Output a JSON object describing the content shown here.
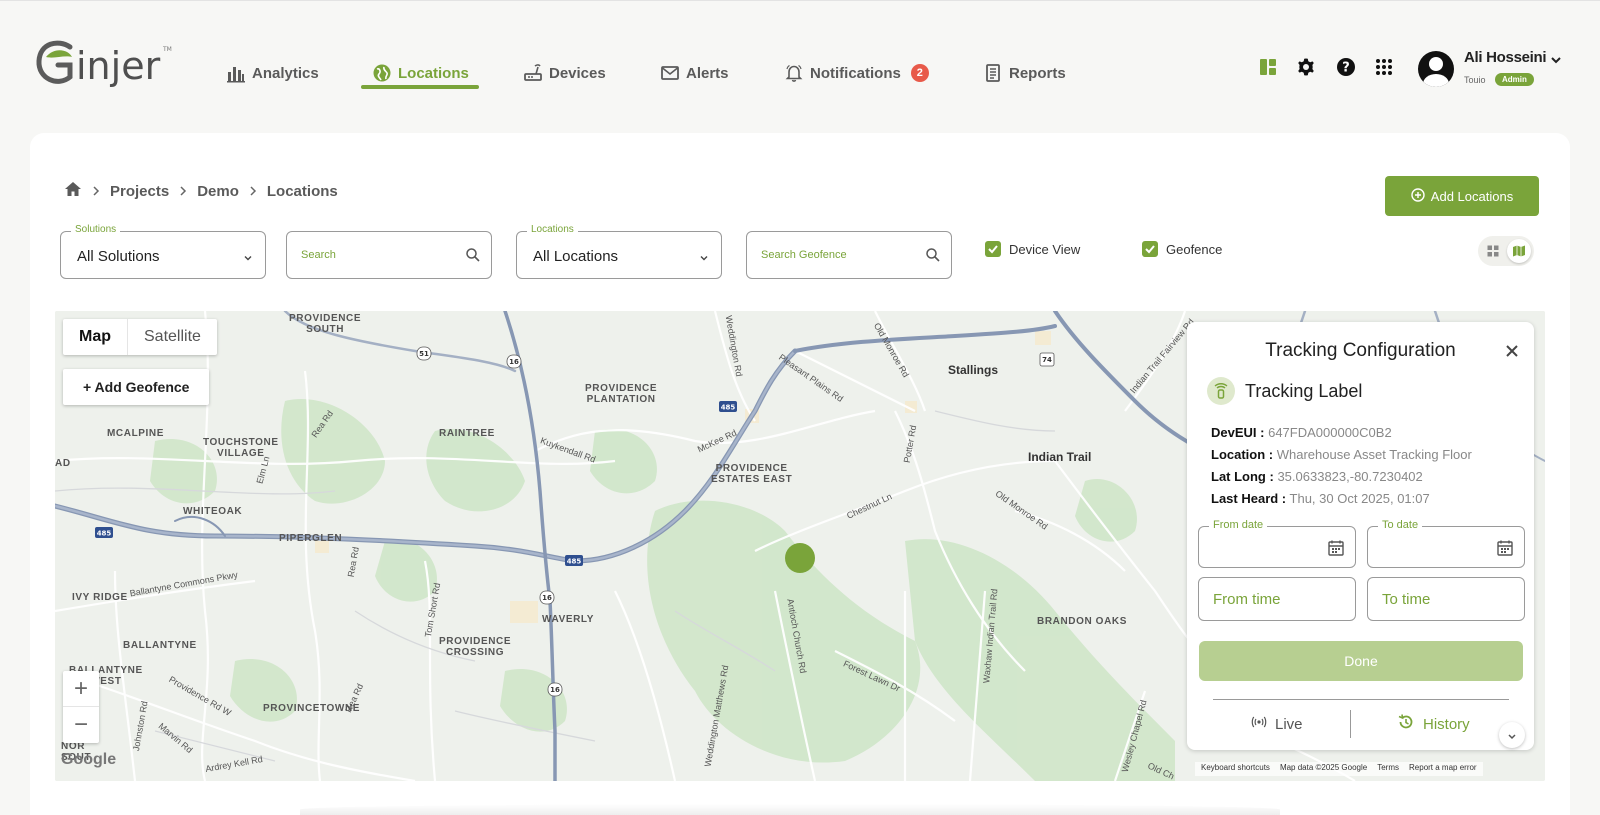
{
  "brand": {
    "logo_text": "Ginjer",
    "accent": "#7aa43a"
  },
  "nav": {
    "items": [
      {
        "label": "Analytics",
        "icon": "bar-chart-icon"
      },
      {
        "label": "Locations",
        "icon": "globe-icon",
        "active": true
      },
      {
        "label": "Devices",
        "icon": "router-icon"
      },
      {
        "label": "Alerts",
        "icon": "mail-icon"
      },
      {
        "label": "Notifications",
        "icon": "bell-icon",
        "badge": "2"
      },
      {
        "label": "Reports",
        "icon": "report-icon"
      }
    ]
  },
  "user": {
    "name": "Ali Hosseini",
    "org": "Touio",
    "role": "Admin"
  },
  "breadcrumb": [
    "Projects",
    "Demo",
    "Locations"
  ],
  "actions": {
    "add_locations": "Add Locations"
  },
  "filters": {
    "solutions": {
      "label": "Solutions",
      "value": "All Solutions"
    },
    "search": {
      "placeholder": "Search"
    },
    "locations": {
      "label": "Locations",
      "value": "All Locations"
    },
    "search_geofence": {
      "placeholder": "Search Geofence"
    },
    "device_view": {
      "label": "Device View",
      "checked": true
    },
    "geofence": {
      "label": "Geofence",
      "checked": true
    }
  },
  "map": {
    "type_map": "Map",
    "type_satellite": "Satellite",
    "add_geofence": "+ Add Geofence",
    "zoom_in": "+",
    "zoom_out": "−",
    "google": "Google",
    "attribution": [
      "Keyboard shortcuts",
      "Map data ©2025 Google",
      "Terms",
      "Report a map error"
    ],
    "labels": {
      "providence_south": "PROVIDENCE\nSOUTH",
      "providence_plantation": "PROVIDENCE\nPLANTATION",
      "stallings": "Stallings",
      "mcalpine": "MCALPINE",
      "touchstone": "TOUCHSTONE\nVILLAGE",
      "raintree": "RAINTREE",
      "providence_estates": "PROVIDENCE\nESTATES EAST",
      "indian_trail": "Indian Trail",
      "whiteoak": "WHITEOAK",
      "piperglen": "PIPERGLEN",
      "ivy_ridge": "IVY RIDGE",
      "waverly": "WAVERLY",
      "brandon_oaks": "BRANDON OAKS",
      "ballantyne": "BALLANTYNE",
      "providence_crossing": "PROVIDENCE\nCROSSING",
      "ballantyne_west": "BALLANTYNE\nWEST",
      "provincetowne": "PROVINCETOWNE",
      "ad": "AD",
      "nors": "NOR\nSOUT"
    },
    "roads": {
      "rea_rd": "Rea Rd",
      "kuykendall": "Kuykendall Rd",
      "mckee": "McKee Rd",
      "pleasant_plains": "Pleasant Plains Rd",
      "old_monroe": "Old Monroe Rd",
      "weddington": "Weddington Rd",
      "chestnut": "Chestnut Ln",
      "potter": "Potter Rd",
      "elm": "Elm Ln",
      "tom_short": "Tom Short Rd",
      "antioch": "Antioch Church Rd",
      "forest_lawn": "Forest Lawn Dr",
      "waxhaw": "Waxhaw Indian Trail Rd",
      "ballantyne_commons": "Ballantyne Commons Pkwy",
      "providence_w": "Providence Rd W",
      "marvin": "Marvin Rd",
      "ardrey": "Ardrey Kell Rd",
      "johnston": "Johnston Rd",
      "weddington_matthews": "Weddington Matthews Rd",
      "wesley_chapel": "Wesley Chapel Rd",
      "indian_trail_fairview": "Indian Trail Fairview Rd",
      "old_monroe_2": "Old Monroe Rd",
      "old_ch": "Old Ch",
      "i485": "485",
      "nc16": "16",
      "nc51": "51",
      "us74": "74"
    }
  },
  "tracking": {
    "title": "Tracking Configuration",
    "label": "Tracking Label",
    "fields": [
      {
        "key": "DevEUI :",
        "value": "647FDA000000C0B2"
      },
      {
        "key": "Location :",
        "value": "Wharehouse Asset Tracking Floor"
      },
      {
        "key": "Lat Long :",
        "value": "35.0633823,-80.7230402"
      },
      {
        "key": "Last Heard :",
        "value": "Thu, 30 Oct 2025, 01:07"
      }
    ],
    "from_date": "From date",
    "to_date": "To date",
    "from_time": "From time",
    "to_time": "To time",
    "done": "Done",
    "tab_live": "Live",
    "tab_history": "History"
  }
}
